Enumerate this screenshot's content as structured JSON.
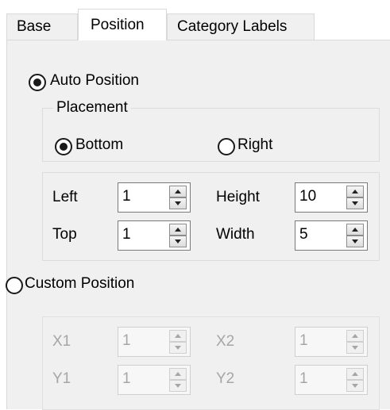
{
  "tabs": [
    {
      "label": "Base"
    },
    {
      "label": "Position"
    },
    {
      "label": "Category Labels"
    }
  ],
  "auto_position": {
    "label": "Auto Position",
    "selected": true
  },
  "placement": {
    "title": "Placement",
    "bottom": {
      "label": "Bottom",
      "selected": true
    },
    "right": {
      "label": "Right",
      "selected": false
    }
  },
  "size_fields": {
    "left": {
      "label": "Left",
      "value": "1"
    },
    "top": {
      "label": "Top",
      "value": "1"
    },
    "height": {
      "label": "Height",
      "value": "10"
    },
    "width": {
      "label": "Width",
      "value": "5"
    }
  },
  "custom_position": {
    "label": "Custom Position",
    "selected": false
  },
  "custom_fields": {
    "x1": {
      "label": "X1",
      "value": "1"
    },
    "y1": {
      "label": "Y1",
      "value": "1"
    },
    "x2": {
      "label": "X2",
      "value": "1"
    },
    "y2": {
      "label": "Y2",
      "value": "1"
    }
  }
}
